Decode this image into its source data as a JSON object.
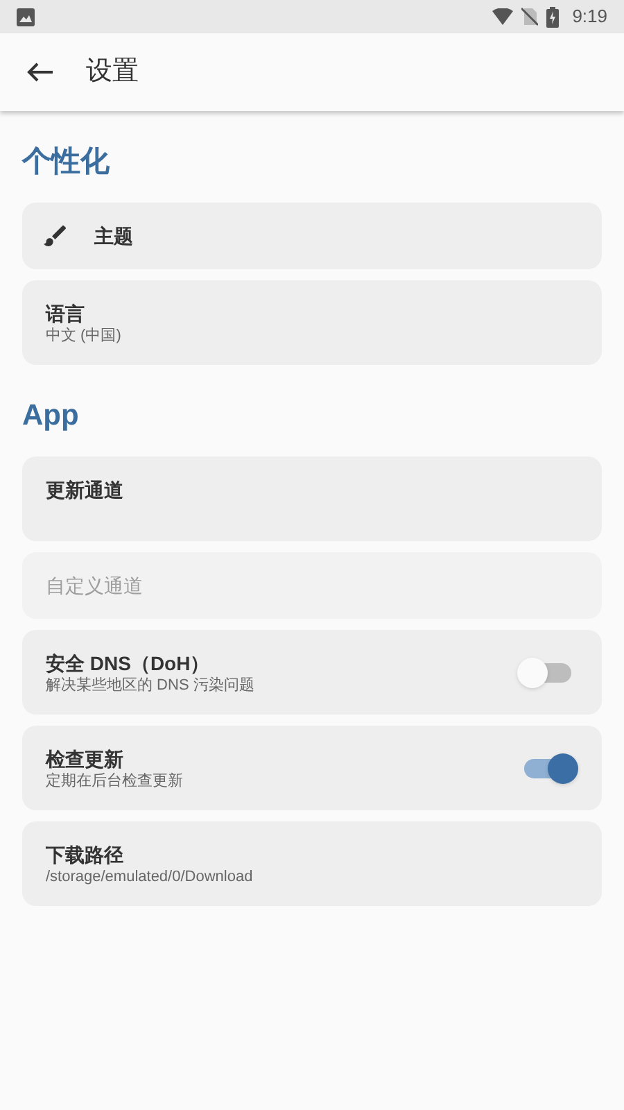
{
  "status_bar": {
    "time": "9:19"
  },
  "app_bar": {
    "title": "设置"
  },
  "sections": [
    {
      "title": "个性化",
      "items": [
        {
          "kind": "icon",
          "title": "主题",
          "disabled": false
        },
        {
          "kind": "text",
          "title": "语言",
          "subtitle": "中文 (中国)",
          "disabled": false
        }
      ]
    },
    {
      "title": "App",
      "items": [
        {
          "kind": "text",
          "title": "更新通道",
          "tall": true,
          "disabled": false
        },
        {
          "kind": "text",
          "title": "自定义通道",
          "disabled": true
        },
        {
          "kind": "switch",
          "title": "安全 DNS（DoH）",
          "subtitle": "解决某些地区的 DNS 污染问题",
          "on": false,
          "disabled": false
        },
        {
          "kind": "switch",
          "title": "检查更新",
          "subtitle": "定期在后台检查更新",
          "on": true,
          "disabled": false
        },
        {
          "kind": "text",
          "title": "下载路径",
          "subtitle": "/storage/emulated/0/Download",
          "disabled": false
        }
      ]
    }
  ]
}
